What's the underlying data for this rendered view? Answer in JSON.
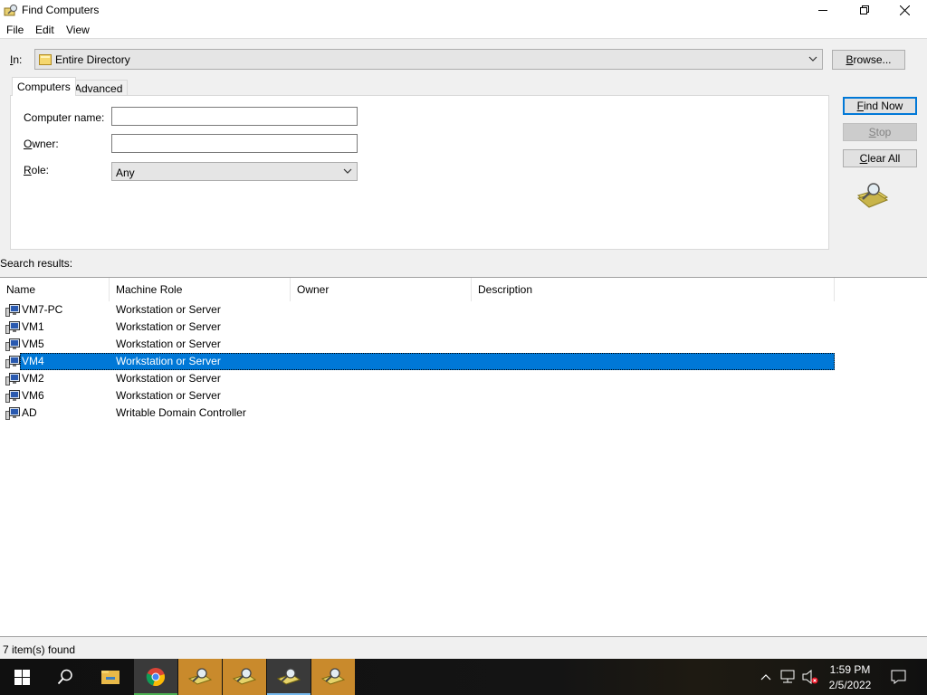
{
  "window": {
    "title": "Find Computers",
    "menu": [
      "File",
      "Edit",
      "View"
    ]
  },
  "scope": {
    "label_prefix": "I",
    "label_under": "n",
    "label_suffix": ":",
    "value": "Entire Directory",
    "browse_under": "B",
    "browse_rest": "rowse..."
  },
  "tabs": [
    {
      "label": "Computers",
      "active": true
    },
    {
      "label": "Advanced",
      "active": false
    }
  ],
  "form": {
    "computer_name_label": "Computer name:",
    "computer_name_value": "",
    "owner_label_under": "O",
    "owner_label_rest": "wner:",
    "owner_value": "",
    "role_label_under": "R",
    "role_label_rest": "ole:",
    "role_value": "Any"
  },
  "buttons": {
    "find_now_under": "F",
    "find_now_rest": "ind Now",
    "stop_under": "S",
    "stop_rest": "top",
    "clear_all_under": "C",
    "clear_all_rest": "lear All"
  },
  "results": {
    "label": "Search results:",
    "columns": [
      "Name",
      "Machine Role",
      "Owner",
      "Description"
    ],
    "rows": [
      {
        "name": "VM7-PC",
        "role": "Workstation or Server",
        "owner": "",
        "description": "",
        "selected": false
      },
      {
        "name": "VM1",
        "role": "Workstation or Server",
        "owner": "",
        "description": "",
        "selected": false
      },
      {
        "name": "VM5",
        "role": "Workstation or Server",
        "owner": "",
        "description": "",
        "selected": false
      },
      {
        "name": "VM4",
        "role": "Workstation or Server",
        "owner": "",
        "description": "",
        "selected": true
      },
      {
        "name": "VM2",
        "role": "Workstation or Server",
        "owner": "",
        "description": "",
        "selected": false
      },
      {
        "name": "VM6",
        "role": "Workstation or Server",
        "owner": "",
        "description": "",
        "selected": false
      },
      {
        "name": "AD",
        "role": "Writable Domain Controller",
        "owner": "",
        "description": "",
        "selected": false
      }
    ]
  },
  "status": "7 item(s) found",
  "taskbar": {
    "time": "1:59 PM",
    "date": "2/5/2022",
    "items": [
      "start-icon",
      "search-icon",
      "file-explorer-icon",
      "chrome-icon",
      "find-computers-icon",
      "find-computers-icon",
      "find-computers-icon",
      "find-computers-icon"
    ]
  },
  "colors": {
    "selection": "#0078d7",
    "taskbar": "#101010",
    "pinned_app": "#c98a2c"
  }
}
